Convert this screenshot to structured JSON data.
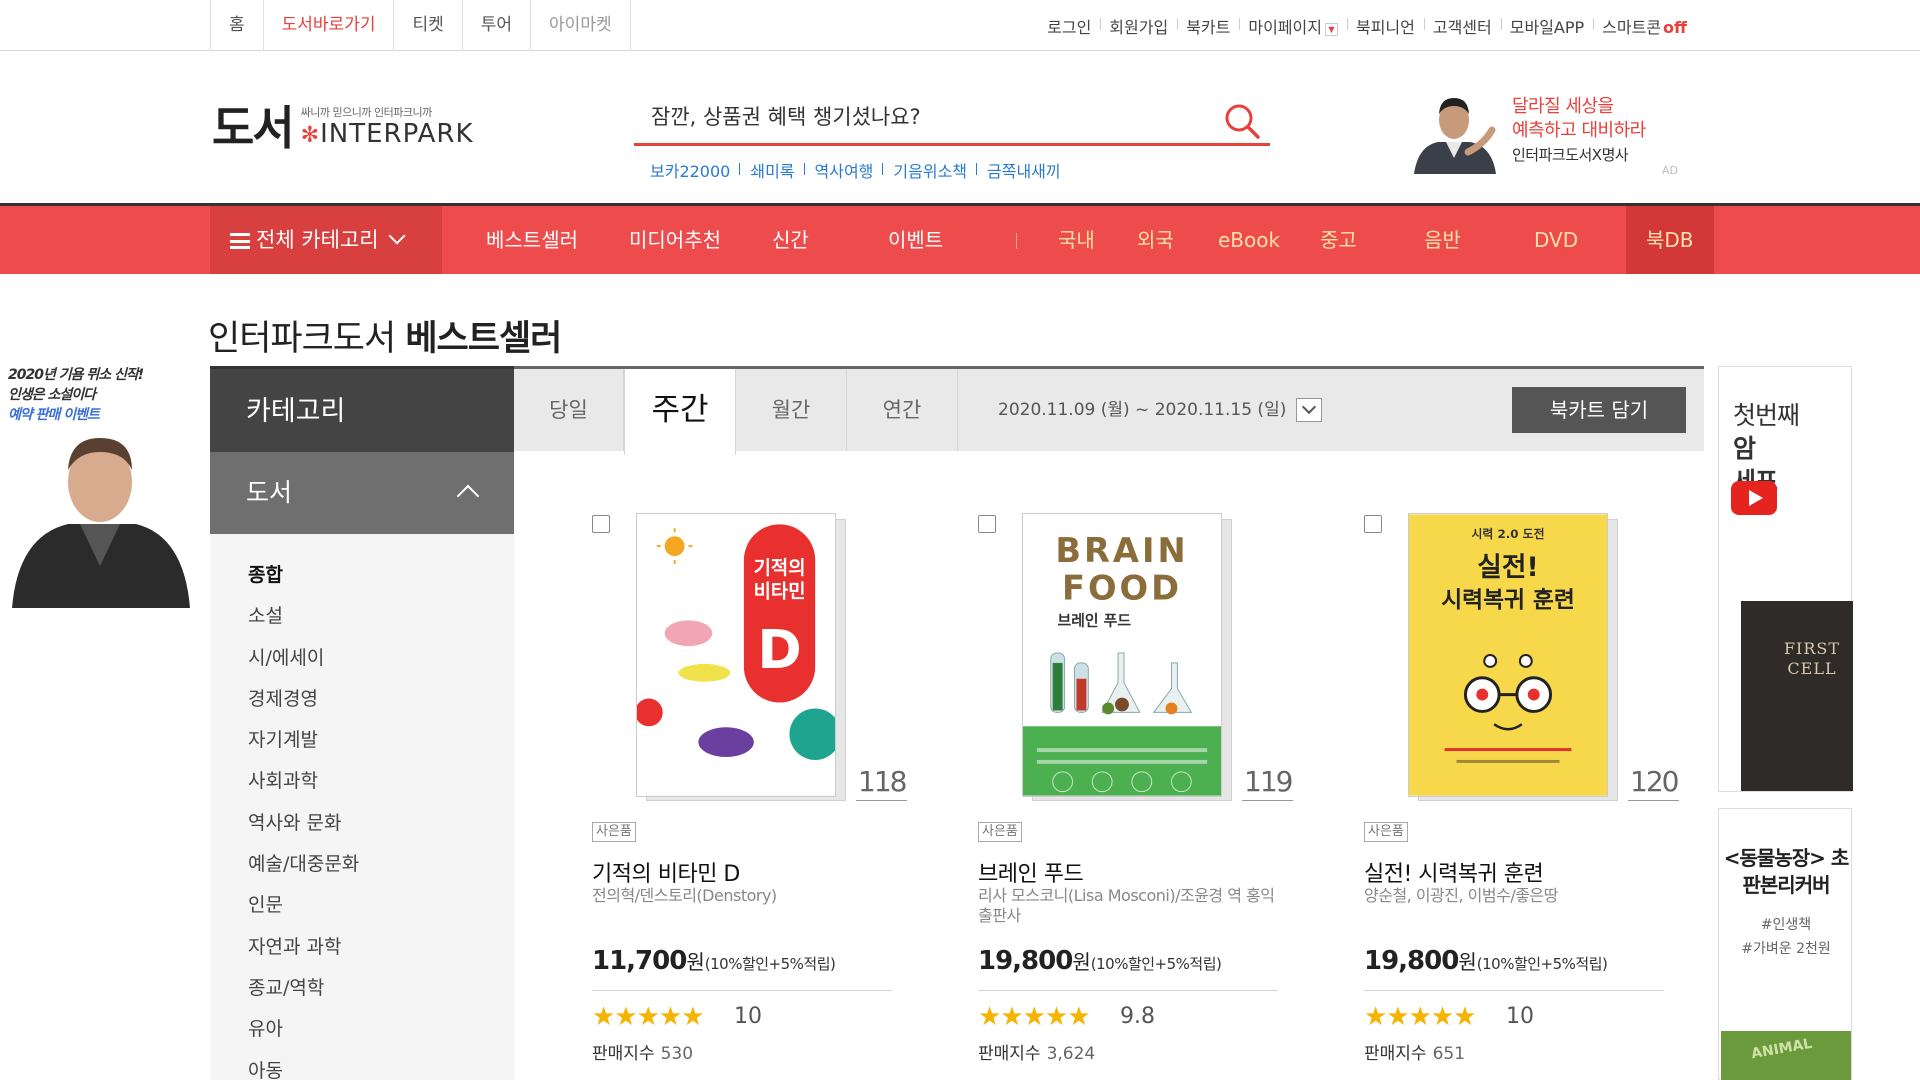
{
  "topnav": {
    "items": [
      "홈",
      "도서바로가기",
      "티켓",
      "투어",
      "아이마켓"
    ],
    "util": [
      "로그인",
      "회원가입",
      "북카트",
      "마이페이지",
      "북피니언",
      "고객센터",
      "모바일APP",
      "스마트콘"
    ],
    "smartcon_state": "off"
  },
  "header": {
    "logo_main": "도서",
    "logo_slogan": "싸니까 믿으니까 인터파크니까",
    "logo_brand": "INTERPARK",
    "search_placeholder": "잠깐, 상품권 혜택 챙기셨나요?",
    "keywords": [
      "보카22000",
      "쇄미록",
      "역사여행",
      "기음위소책",
      "금쪽내새끼"
    ],
    "ad": {
      "line1": "달라질 세상을",
      "line2": "예측하고 대비하라",
      "line3": "인터파크도서X명사",
      "tag": "AD"
    }
  },
  "mainnav": {
    "all_category": "전체 카테고리",
    "primary": [
      "베스트셀러",
      "미디어추천",
      "신간",
      "이벤트"
    ],
    "secondary": [
      "국내",
      "외국",
      "eBook",
      "중고",
      "음반",
      "DVD"
    ],
    "bookdb": "북DB"
  },
  "left_banner": {
    "line1": "2020년 기욤 뮈소 신작!",
    "line2": "인생은 소설이다",
    "line3": "예약 판매 이벤트"
  },
  "page_title": {
    "prefix": "인터파크도서",
    "main": "베스트셀러"
  },
  "sidebar": {
    "heading": "카테고리",
    "section": "도서",
    "items": [
      "종합",
      "소설",
      "시/에세이",
      "경제경영",
      "자기계발",
      "사회과학",
      "역사와 문화",
      "예술/대중문화",
      "인문",
      "자연과 과학",
      "종교/역학",
      "유아",
      "아동"
    ]
  },
  "period_tabs": {
    "tabs": [
      "당일",
      "주간",
      "월간",
      "연간"
    ],
    "active": "주간",
    "date_range": "2020.11.09 (월) ~ 2020.11.15 (일)",
    "cart_button": "북카트 담기"
  },
  "books": [
    {
      "rank": "118",
      "gift": "사은품",
      "title": "기적의 비타민 D",
      "author": "전의혁/덴스토리(Denstory)",
      "price": "11,700",
      "won": "원",
      "discount": "(10%할인+5%적립)",
      "stars": "★★★★★",
      "score": "10",
      "sales_label": "판매지수",
      "sales": "530",
      "cover_title_1": "기적의",
      "cover_title_2": "비타민",
      "cover_letter": "D"
    },
    {
      "rank": "119",
      "gift": "사은품",
      "title": "브레인 푸드",
      "author": "리사 모스코니(Lisa Mosconi)/조윤경 역 홍익출판사",
      "price": "19,800",
      "won": "원",
      "discount": "(10%할인+5%적립)",
      "stars": "★★★★★",
      "score": "9.8",
      "sales_label": "판매지수",
      "sales": "3,624",
      "cover_title_1": "BRAIN",
      "cover_title_2": "FOOD",
      "cover_letter": "브레인 푸드"
    },
    {
      "rank": "120",
      "gift": "사은품",
      "title": "실전! 시력복귀 훈련",
      "author": "양순철, 이광진, 이범수/좋은땅",
      "price": "19,800",
      "won": "원",
      "discount": "(10%할인+5%적립)",
      "stars": "★★★★★",
      "score": "10",
      "sales_label": "판매지수",
      "sales": "651",
      "cover_title_1": "시력 2.0 도전",
      "cover_title_2": "실전!",
      "cover_letter": "시력복귀 훈련"
    }
  ],
  "right_ads": {
    "ad1_lines": [
      "첫번째",
      "암",
      "세포"
    ],
    "ad1_book": "FIRST CELL",
    "ad2_title": "<동물농장> 초판본리커버",
    "ad2_tags": [
      "#인생책",
      "#가벼운 2천원"
    ],
    "ad2_band": "ANIMAL"
  },
  "colors": {
    "accent": "#ee4c4c",
    "accent_dark": "#d8403f",
    "link": "#2a7bcf",
    "star": "#f5b400"
  }
}
